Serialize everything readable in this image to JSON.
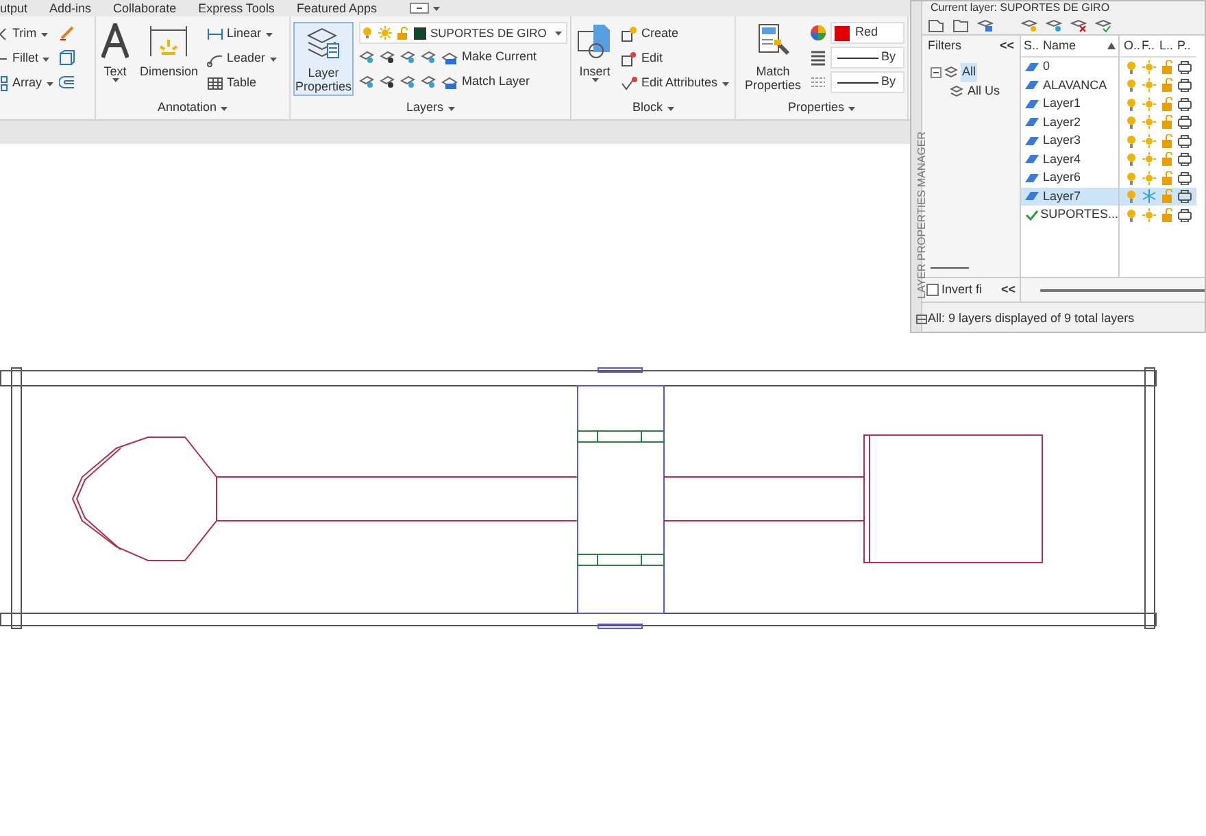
{
  "ribbon_tabs": [
    {
      "label": "utput",
      "selected": false
    },
    {
      "label": "Add-ins",
      "selected": false
    },
    {
      "label": "Collaborate",
      "selected": false
    },
    {
      "label": "Express Tools",
      "selected": false
    },
    {
      "label": "Featured Apps",
      "selected": false
    }
  ],
  "modify_panel": {
    "tools": [
      "Trim",
      "Fillet",
      "Array"
    ]
  },
  "annotation_panel": {
    "big_tools": [
      "Text",
      "Dimension"
    ],
    "tools": [
      "Linear",
      "Leader",
      "Table"
    ],
    "title": "Annotation"
  },
  "layers_panel": {
    "big_tool": {
      "label": "Layer Properties",
      "selected": true
    },
    "current_layer": {
      "name": "SUPORTES DE GIRO",
      "color": "#0b4a2a"
    },
    "tools": [
      "Make Current",
      "Match Layer"
    ],
    "title": "Layers"
  },
  "block_panel": {
    "big_tool": "Insert",
    "tools": [
      "Create",
      "Edit",
      "Edit Attributes"
    ],
    "title": "Block"
  },
  "properties_panel": {
    "big_tool": "Match Properties",
    "color": {
      "name": "Red",
      "color": "#e00000"
    },
    "lineweight": "By",
    "linetype": "By",
    "title": "Properties"
  },
  "layer_manager": {
    "title": "LAYER PROPERTIES MANAGER",
    "current_layer_label": "Current layer: SUPORTES DE GIRO",
    "filters": {
      "header": "Filters",
      "collapse": "<<",
      "tree": [
        {
          "label": "All",
          "selected": true,
          "children": [
            {
              "label": "All Us",
              "selected": false
            }
          ]
        }
      ],
      "invert_label": "Invert fi",
      "invert_checked": false,
      "collapse_bottom": "<<"
    },
    "columns": [
      "S..",
      "Name",
      "O..",
      "F..",
      "L..",
      "P.."
    ],
    "layers": [
      {
        "name": "0",
        "current": false,
        "selected": false,
        "frozen": false
      },
      {
        "name": "ALAVANCA",
        "current": false,
        "selected": false,
        "frozen": false
      },
      {
        "name": "Layer1",
        "current": false,
        "selected": false,
        "frozen": false
      },
      {
        "name": "Layer2",
        "current": false,
        "selected": false,
        "frozen": false
      },
      {
        "name": "Layer3",
        "current": false,
        "selected": false,
        "frozen": false
      },
      {
        "name": "Layer4",
        "current": false,
        "selected": false,
        "frozen": false
      },
      {
        "name": "Layer6",
        "current": false,
        "selected": false,
        "frozen": false
      },
      {
        "name": "Layer7",
        "current": false,
        "selected": true,
        "frozen": true
      },
      {
        "name": "SUPORTES...",
        "current": true,
        "selected": false,
        "frozen": false
      }
    ],
    "status": "All: 9 layers displayed of 9 total layers"
  }
}
